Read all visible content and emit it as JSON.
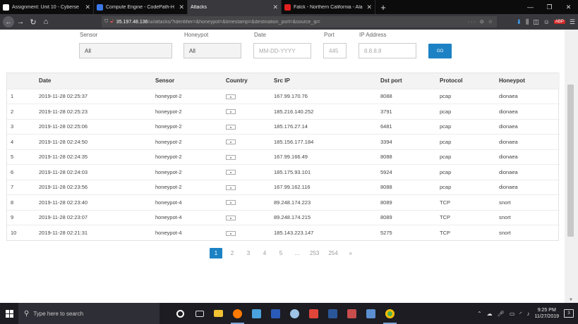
{
  "browser": {
    "tabs": [
      {
        "title": "Assignment: Unit 10 - Cyberse",
        "favicon_color": "#ffffff",
        "active": false
      },
      {
        "title": "Compute Engine - CodePath-H",
        "favicon_color": "#3b78e7",
        "active": false
      },
      {
        "title": "Attacks",
        "favicon_color": "",
        "active": true
      },
      {
        "title": "Falck - Northern California - Ala",
        "favicon_color": "#e32020",
        "active": false
      }
    ],
    "url_host": "35.197.48.136",
    "url_path": "/ui/attacks/?identifier=&honeypot=&timestamp=&destination_port=&source_ip=",
    "url_right": "··· ⊙ ☆"
  },
  "filters": {
    "sensor": {
      "label": "Sensor",
      "value": "All"
    },
    "honeypot": {
      "label": "Honeypot",
      "value": "All"
    },
    "date": {
      "label": "Date",
      "placeholder": "MM-DD-YYYY"
    },
    "port": {
      "label": "Port",
      "placeholder": "445"
    },
    "ip": {
      "label": "IP Address",
      "placeholder": "8.8.8.8"
    },
    "go_label": "GO"
  },
  "table": {
    "headers": [
      "",
      "Date",
      "Sensor",
      "Country",
      "Src IP",
      "Dst port",
      "Protocol",
      "Honeypot"
    ],
    "rows": [
      [
        "1",
        "2019-11-28 02:25:37",
        "honeypot-2",
        "167.99.170.76",
        "8088",
        "pcap",
        "dionaea"
      ],
      [
        "2",
        "2019-11-28 02:25:23",
        "honeypot-2",
        "185.216.140.252",
        "3791",
        "pcap",
        "dionaea"
      ],
      [
        "3",
        "2019-11-28 02:25:06",
        "honeypot-2",
        "185.176.27.14",
        "6481",
        "pcap",
        "dionaea"
      ],
      [
        "4",
        "2019-11-28 02:24:50",
        "honeypot-2",
        "185.156.177.184",
        "3394",
        "pcap",
        "dionaea"
      ],
      [
        "5",
        "2019-11-28 02:24:35",
        "honeypot-2",
        "167.99.166.49",
        "8088",
        "pcap",
        "dionaea"
      ],
      [
        "6",
        "2019-11-28 02:24:03",
        "honeypot-2",
        "185.175.93.101",
        "5924",
        "pcap",
        "dionaea"
      ],
      [
        "7",
        "2019-11-28 02:23:56",
        "honeypot-2",
        "167.99.162.116",
        "8088",
        "pcap",
        "dionaea"
      ],
      [
        "8",
        "2019-11-28 02:23:40",
        "honeypot-4",
        "89.248.174.223",
        "8089",
        "TCP",
        "snort"
      ],
      [
        "9",
        "2019-11-28 02:23:07",
        "honeypot-4",
        "89.248.174.215",
        "8089",
        "TCP",
        "snort"
      ],
      [
        "10",
        "2019-11-28 02:21:31",
        "honeypot-4",
        "185.143.223.147",
        "5275",
        "TCP",
        "snort"
      ]
    ]
  },
  "pagination": [
    "1",
    "2",
    "3",
    "4",
    "5",
    "...",
    "253",
    "254",
    "»"
  ],
  "taskbar": {
    "search_placeholder": "Type here to search",
    "time": "9:25 PM",
    "date": "11/27/2019",
    "notification_count": "3"
  }
}
